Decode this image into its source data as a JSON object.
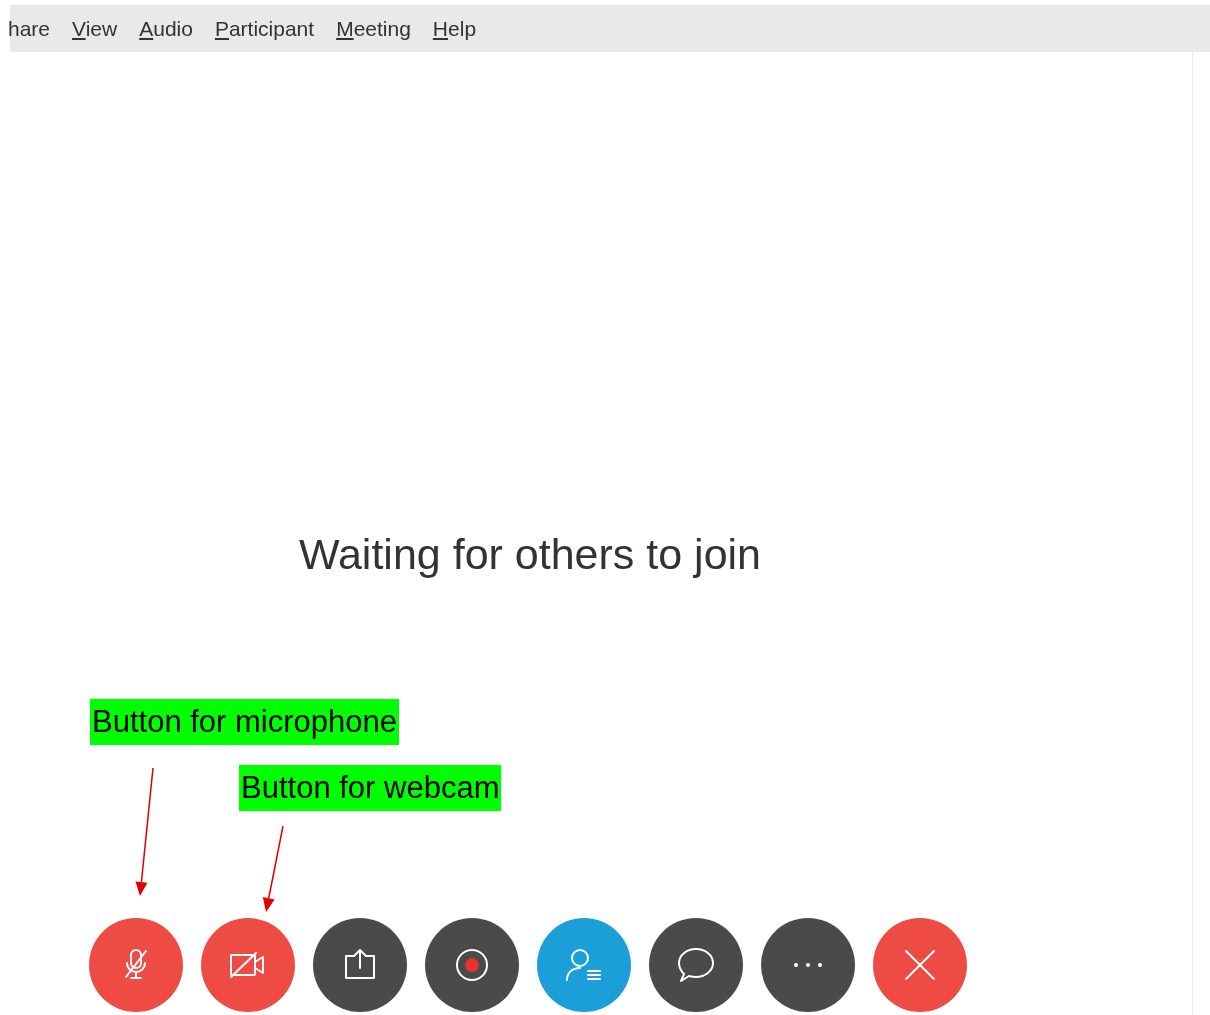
{
  "menu_bar": [
    {
      "label": "hare",
      "mnemonic": false
    },
    {
      "label": "View",
      "mnemonic": true
    },
    {
      "label": "Audio",
      "mnemonic": true
    },
    {
      "label": "Participant",
      "mnemonic": true
    },
    {
      "label": "Meeting",
      "mnemonic": true
    },
    {
      "label": "Help",
      "mnemonic": true
    }
  ],
  "status_message": "Waiting for others to join",
  "controls": [
    {
      "kind": "microphone-muted",
      "color": "#ef4b45"
    },
    {
      "kind": "camera-off",
      "color": "#ef4b45"
    },
    {
      "kind": "share",
      "color": "#4a4a4a"
    },
    {
      "kind": "record",
      "color": "#4a4a4a"
    },
    {
      "kind": "participants",
      "color": "#1a9fd9"
    },
    {
      "kind": "chat",
      "color": "#4a4a4a"
    },
    {
      "kind": "more",
      "color": "#4a4a4a"
    },
    {
      "kind": "leave",
      "color": "#ef4b45"
    }
  ],
  "annotations": [
    {
      "text": "Button for microphone"
    },
    {
      "text": "Button for webcam"
    }
  ]
}
